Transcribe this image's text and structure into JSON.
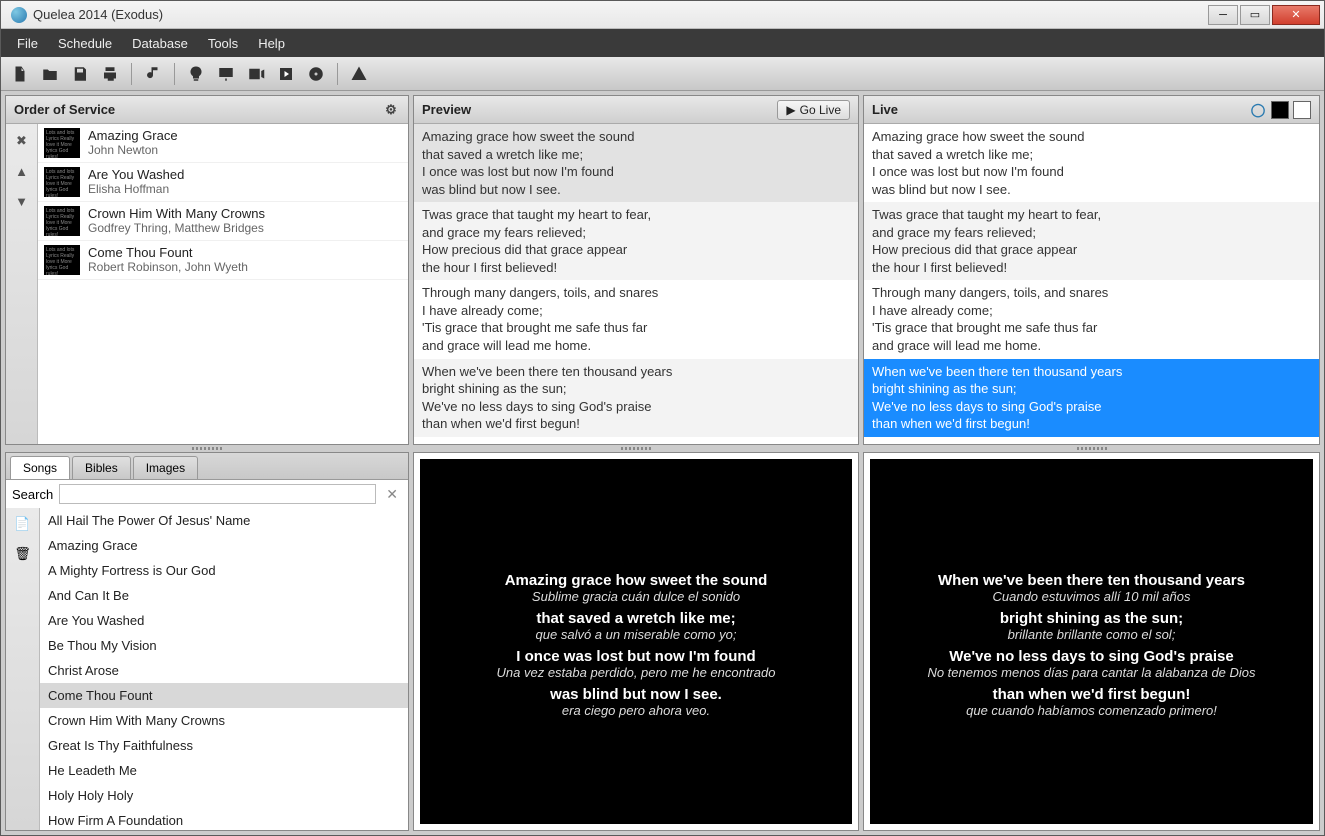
{
  "window": {
    "title": "Quelea 2014 (Exodus)"
  },
  "menu": {
    "file": "File",
    "schedule": "Schedule",
    "database": "Database",
    "tools": "Tools",
    "help": "Help"
  },
  "panels": {
    "order": "Order of Service",
    "preview": "Preview",
    "live": "Live",
    "golive": "Go Live"
  },
  "order_items": [
    {
      "title": "Amazing Grace",
      "author": "John Newton"
    },
    {
      "title": "Are You Washed",
      "author": "Elisha Hoffman"
    },
    {
      "title": "Crown Him With Many Crowns",
      "author": "Godfrey Thring, Matthew Bridges"
    },
    {
      "title": "Come Thou Fount",
      "author": "Robert Robinson, John Wyeth"
    }
  ],
  "library": {
    "tabs": {
      "songs": "Songs",
      "bibles": "Bibles",
      "images": "Images"
    },
    "search_label": "Search",
    "search_value": "",
    "selected": "Come Thou Fount",
    "songs": [
      "All Hail The Power Of Jesus' Name",
      "Amazing Grace",
      "A Mighty Fortress is Our God",
      "And Can It Be",
      "Are You Washed",
      "Be Thou My Vision",
      "Christ Arose",
      "Come Thou Fount",
      "Crown Him With Many Crowns",
      "Great Is Thy Faithfulness",
      "He Leadeth Me",
      "Holy Holy Holy",
      "How Firm A Foundation"
    ]
  },
  "verses": [
    [
      "Amazing grace how sweet the sound",
      "that saved a wretch like me;",
      "I once was lost but now I'm found",
      "was blind but now I see."
    ],
    [
      "Twas grace that taught my heart to fear,",
      "and grace my fears relieved;",
      "How precious did that grace appear",
      "the hour I first believed!"
    ],
    [
      "Through many dangers, toils, and snares",
      "I have already come;",
      "'Tis grace that brought me safe thus far",
      "and grace will lead me home."
    ],
    [
      "When we've been there ten thousand years",
      "bright shining as the sun;",
      "We've no less days to sing God's praise",
      "than when we'd first begun!"
    ]
  ],
  "live_selected_index": 3,
  "preview_screen": {
    "pairs": [
      [
        "Amazing grace how sweet the sound",
        "Sublime gracia cuán dulce el sonido"
      ],
      [
        "that saved a wretch like me;",
        "que salvó a un miserable como yo;"
      ],
      [
        "I once was lost but now I'm found",
        "Una vez estaba perdido, pero me he encontrado"
      ],
      [
        "was blind but now I see.",
        "era ciego pero ahora veo."
      ]
    ]
  },
  "live_screen": {
    "pairs": [
      [
        "When we've been there ten thousand years",
        "Cuando estuvimos allí 10 mil años"
      ],
      [
        "bright shining as the sun;",
        "brillante brillante como el sol;"
      ],
      [
        "We've no less days to sing God's praise",
        "No tenemos menos días para cantar la alabanza de Dios"
      ],
      [
        "than when we'd first begun!",
        "que cuando habíamos comenzado primero!"
      ]
    ]
  }
}
